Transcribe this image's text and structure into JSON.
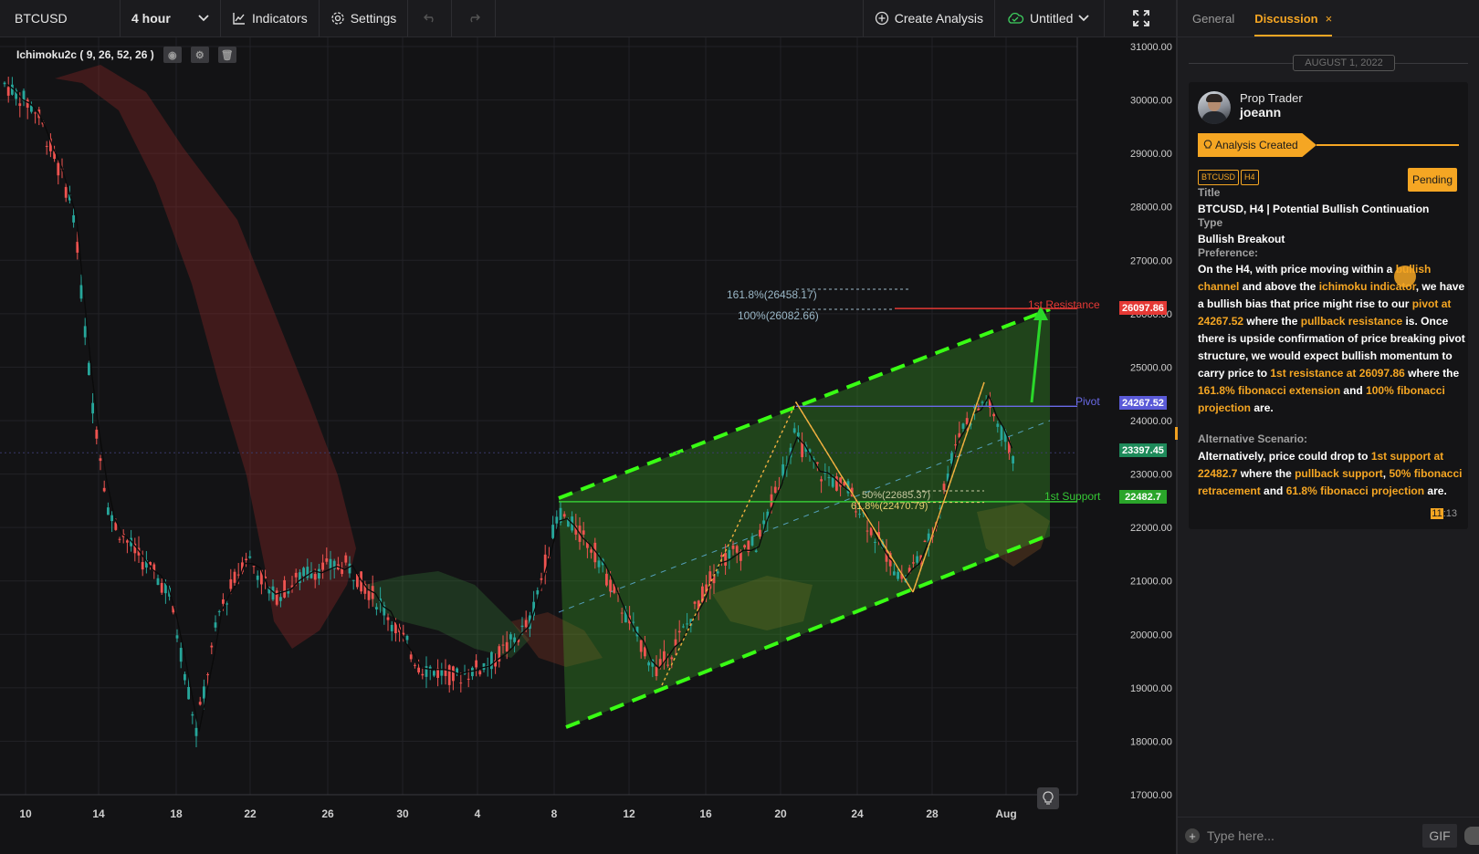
{
  "toolbar": {
    "symbol": "BTCUSD",
    "interval": "4 hour",
    "indicators_label": "Indicators",
    "settings_label": "Settings",
    "create_analysis_label": "Create Analysis",
    "layout_name": "Untitled"
  },
  "chart": {
    "indicator_legend": "Ichimoku2c ( 9, 26, 52, 26 )",
    "y_axis_labels": [
      "31000.00",
      "30000.00",
      "29000.00",
      "28000.00",
      "27000.00",
      "26000.00",
      "25000.00",
      "24000.00",
      "23000.00",
      "22000.00",
      "21000.00",
      "20000.00",
      "19000.00",
      "18000.00",
      "17000.00"
    ],
    "x_axis_labels": [
      "10",
      "14",
      "18",
      "22",
      "26",
      "30",
      "4",
      "8",
      "12",
      "16",
      "20",
      "24",
      "28",
      "Aug"
    ],
    "price_tags": {
      "resistance": "26097.86",
      "pivot": "24267.52",
      "current": "23397.45",
      "support": "22482.7"
    },
    "annotations": {
      "resistance_label": "1st Resistance",
      "pivot_label": "Pivot",
      "support_label": "1st Support",
      "fib_1618": "161.8%(26458.17)",
      "fib_100": "100%(26082.66)",
      "fib_50": "50%(22685.37)",
      "fib_618": "61.8%(22470.79)"
    },
    "colors": {
      "bull": "#26a69a",
      "bear": "#ef5350",
      "channel": "#39ff14",
      "resistance": "#e53935",
      "pivot": "#6a6ae8",
      "support": "#35c835",
      "accent": "#f5a623"
    }
  },
  "panel": {
    "tab_general": "General",
    "tab_discussion": "Discussion",
    "tab_close": "×",
    "date_separator": "AUGUST 1, 2022",
    "author_role": "Prop Trader",
    "author_name": "joeann",
    "status_banner": "Analysis Created",
    "tags": [
      "BTCUSD",
      "H4"
    ],
    "status_badge": "Pending",
    "title_label": "Title",
    "title_value": "BTCUSD, H4 | Potential Bullish Continuation",
    "type_label": "Type",
    "type_value": "Bullish Breakout",
    "preference_label": "Preference:",
    "preference_text": {
      "p1": "On the H4, with price moving within a ",
      "h1": "bullish channel",
      "p2": " and above the ",
      "h2": "ichimoku indicator",
      "p3": ", we have a bullish bias that price might rise to our ",
      "h3": "pivot at 24267.52",
      "p4": " where the ",
      "h4": "pullback resistance",
      "p5": " is. Once there is upside confirmation of price breaking pivot structure, we would expect bullish momentum to carry price to ",
      "h5": "1st resistance at 26097.86",
      "p6": " where the ",
      "h6": "161.8% fibonacci extension",
      "p7": " and ",
      "h7": "100% fibonacci projection",
      "p8": " are."
    },
    "alt_label": "Alternative Scenario:",
    "alt_text": {
      "p1": "Alternatively, price could drop to ",
      "h1": "1st support at 22482.7",
      "p2": " where the ",
      "h2": "pullback support",
      "p3": ", ",
      "h3": "50% fibonacci retracement",
      "p4": " and ",
      "h4": "61.8% fibonacci projection",
      "p5": " are."
    },
    "timestamp_hour": "11",
    "timestamp_min": ":13",
    "input_placeholder": "Type here...",
    "gif_label": "GIF"
  }
}
